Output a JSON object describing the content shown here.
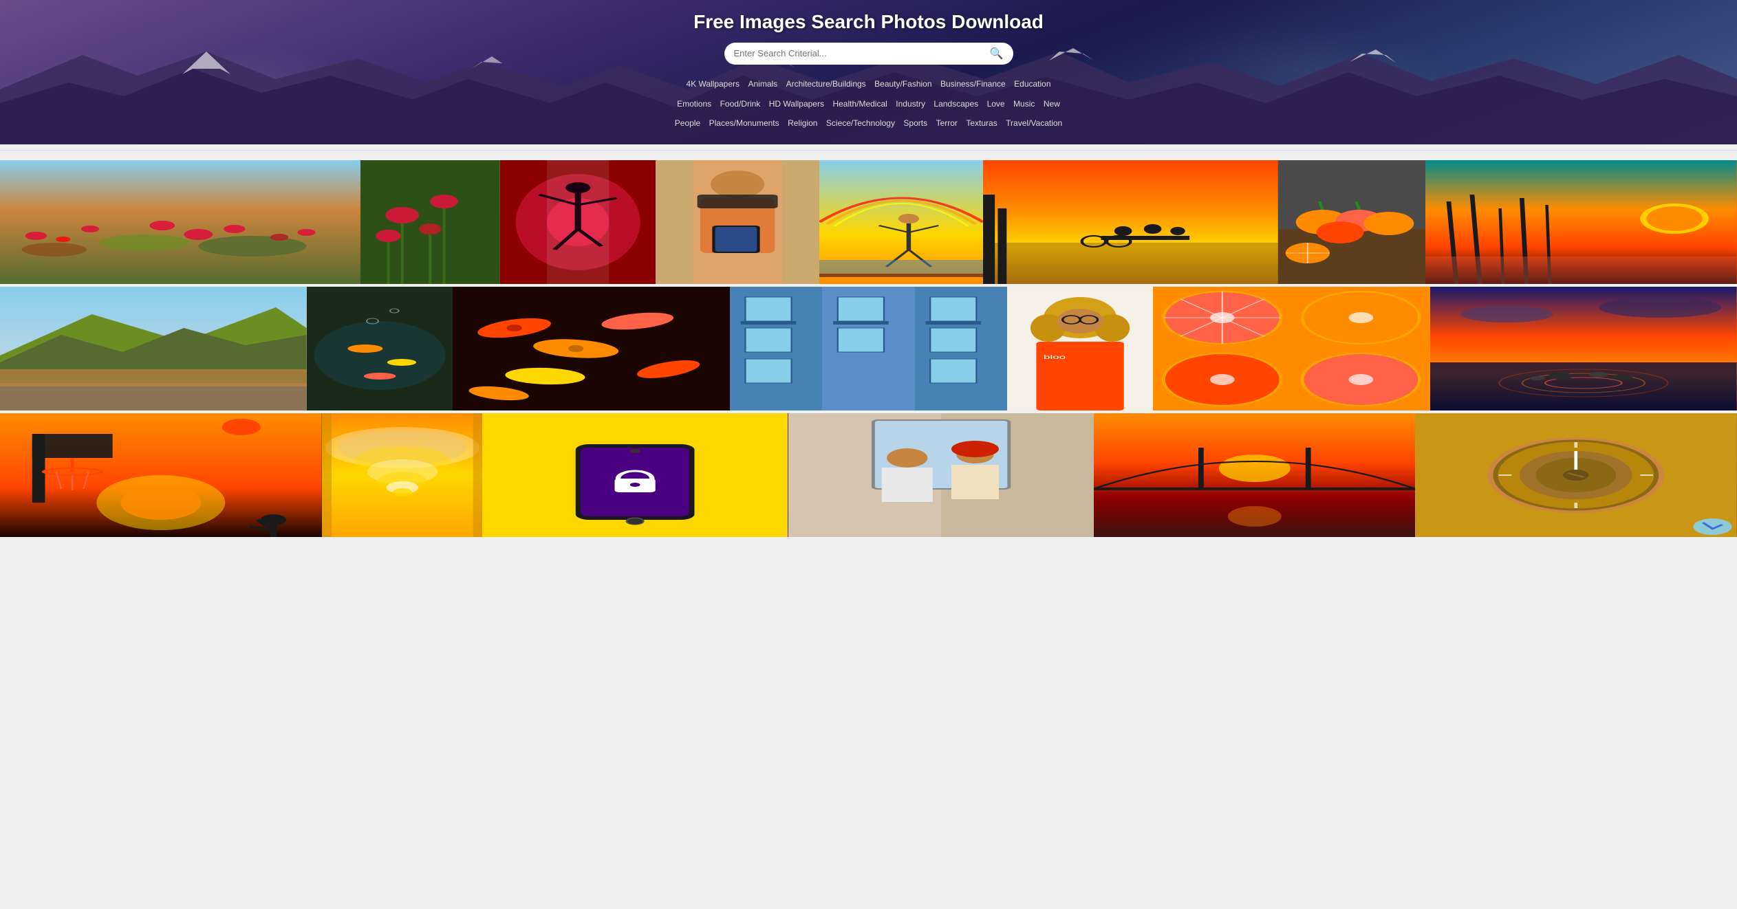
{
  "hero": {
    "title": "Free Images Search Photos Download",
    "search": {
      "placeholder": "Enter Search Criterial...",
      "button_label": "🔍"
    },
    "categories_row1": [
      "4K Wallpapers",
      "Animals",
      "Architecture/Buildings",
      "Beauty/Fashion",
      "Business/Finance",
      "Education"
    ],
    "categories_row2": [
      "Emotions",
      "Food/Drink",
      "HD Wallpapers",
      "Health/Medical",
      "Industry",
      "Landscapes",
      "Love",
      "Music",
      "New"
    ],
    "categories_row3": [
      "People",
      "Places/Monuments",
      "Religion",
      "Sciece/Technology",
      "Sports",
      "Terror",
      "Texturas",
      "Travel/Vacation"
    ]
  },
  "gallery": {
    "rows": [
      {
        "id": "row1",
        "items": [
          {
            "id": "r1i1",
            "alt": "Red poppy field"
          },
          {
            "id": "r1i2",
            "alt": "Poppies closeup"
          },
          {
            "id": "r1i3",
            "alt": "Dancer in red"
          },
          {
            "id": "r1i4",
            "alt": "Woman with tablet"
          },
          {
            "id": "r1i5",
            "alt": "Acrobat with rainbow"
          },
          {
            "id": "r1i6",
            "alt": "Sunset with bikes"
          },
          {
            "id": "r1i7",
            "alt": "Persimmons on table"
          },
          {
            "id": "r1i8",
            "alt": "Sunset through reeds"
          }
        ]
      },
      {
        "id": "row2",
        "items": [
          {
            "id": "r2i1",
            "alt": "Mountains landscape"
          },
          {
            "id": "r2i2",
            "alt": "Goldfish underwater"
          },
          {
            "id": "r2i3",
            "alt": "Koi fish"
          },
          {
            "id": "r2i4",
            "alt": "Colorful building facade"
          },
          {
            "id": "r2i5",
            "alt": "Woman with curly hair"
          },
          {
            "id": "r2i6",
            "alt": "Orange slices"
          },
          {
            "id": "r2i7",
            "alt": "Sunset reflection stones"
          }
        ]
      },
      {
        "id": "row3",
        "items": [
          {
            "id": "r3i1",
            "alt": "Basketball sunset"
          },
          {
            "id": "r3i2",
            "alt": "Tunnel arches"
          },
          {
            "id": "r3i3",
            "alt": "Phone with lock"
          },
          {
            "id": "r3i4",
            "alt": "People bathroom"
          },
          {
            "id": "r3i5",
            "alt": "Sunset bridge"
          },
          {
            "id": "r3i6",
            "alt": "Knob golden"
          }
        ]
      }
    ]
  }
}
